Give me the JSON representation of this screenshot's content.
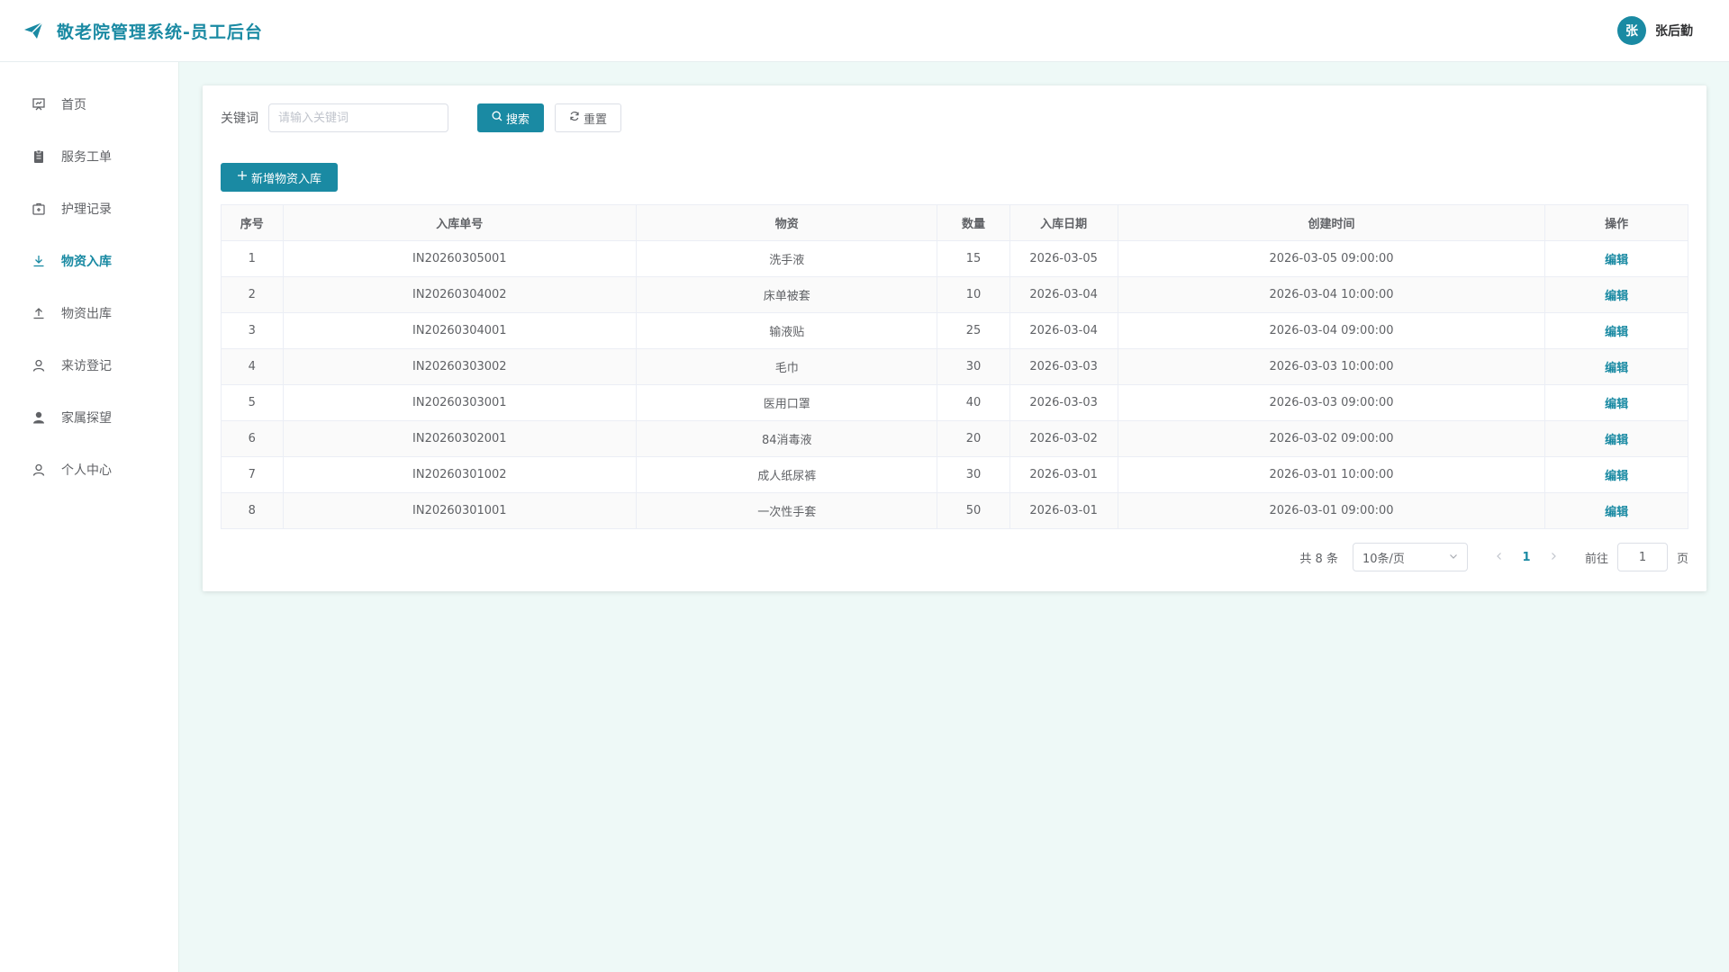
{
  "header": {
    "title": "敬老院管理系统-员工后台",
    "avatar_text": "张",
    "user_name": "张后勤"
  },
  "sidebar": {
    "items": [
      {
        "label": "首页",
        "icon": "presentation-icon"
      },
      {
        "label": "服务工单",
        "icon": "clipboard-icon"
      },
      {
        "label": "护理记录",
        "icon": "first-aid-icon"
      },
      {
        "label": "物资入库",
        "icon": "download-icon",
        "active": true
      },
      {
        "label": "物资出库",
        "icon": "upload-icon"
      },
      {
        "label": "来访登记",
        "icon": "user-outline-icon"
      },
      {
        "label": "家属探望",
        "icon": "user-filled-icon"
      },
      {
        "label": "个人中心",
        "icon": "user-outline-icon"
      }
    ]
  },
  "search": {
    "label": "关键词",
    "placeholder": "请输入关键词",
    "value": "",
    "search_button": "搜索",
    "reset_button": "重置"
  },
  "toolbar": {
    "add_button": "新增物资入库"
  },
  "table": {
    "columns": [
      "序号",
      "入库单号",
      "物资",
      "数量",
      "入库日期",
      "创建时间",
      "操作"
    ],
    "rows": [
      {
        "index": "1",
        "order_no": "IN20260305001",
        "item": "洗手液",
        "qty": "15",
        "date": "2026-03-05",
        "created": "2026-03-05 09:00:00",
        "action": "编辑"
      },
      {
        "index": "2",
        "order_no": "IN20260304002",
        "item": "床单被套",
        "qty": "10",
        "date": "2026-03-04",
        "created": "2026-03-04 10:00:00",
        "action": "编辑"
      },
      {
        "index": "3",
        "order_no": "IN20260304001",
        "item": "输液贴",
        "qty": "25",
        "date": "2026-03-04",
        "created": "2026-03-04 09:00:00",
        "action": "编辑"
      },
      {
        "index": "4",
        "order_no": "IN20260303002",
        "item": "毛巾",
        "qty": "30",
        "date": "2026-03-03",
        "created": "2026-03-03 10:00:00",
        "action": "编辑"
      },
      {
        "index": "5",
        "order_no": "IN20260303001",
        "item": "医用口罩",
        "qty": "40",
        "date": "2026-03-03",
        "created": "2026-03-03 09:00:00",
        "action": "编辑"
      },
      {
        "index": "6",
        "order_no": "IN20260302001",
        "item": "84消毒液",
        "qty": "20",
        "date": "2026-03-02",
        "created": "2026-03-02 09:00:00",
        "action": "编辑"
      },
      {
        "index": "7",
        "order_no": "IN20260301002",
        "item": "成人纸尿裤",
        "qty": "30",
        "date": "2026-03-01",
        "created": "2026-03-01 10:00:00",
        "action": "编辑"
      },
      {
        "index": "8",
        "order_no": "IN20260301001",
        "item": "一次性手套",
        "qty": "50",
        "date": "2026-03-01",
        "created": "2026-03-01 09:00:00",
        "action": "编辑"
      }
    ]
  },
  "pagination": {
    "total_text": "共 8 条",
    "page_size": "10条/页",
    "current_page": "1",
    "goto_label": "前往",
    "goto_value": "1",
    "page_unit": "页"
  },
  "colors": {
    "primary": "#1a8aa3",
    "background": "#eef9f7"
  }
}
